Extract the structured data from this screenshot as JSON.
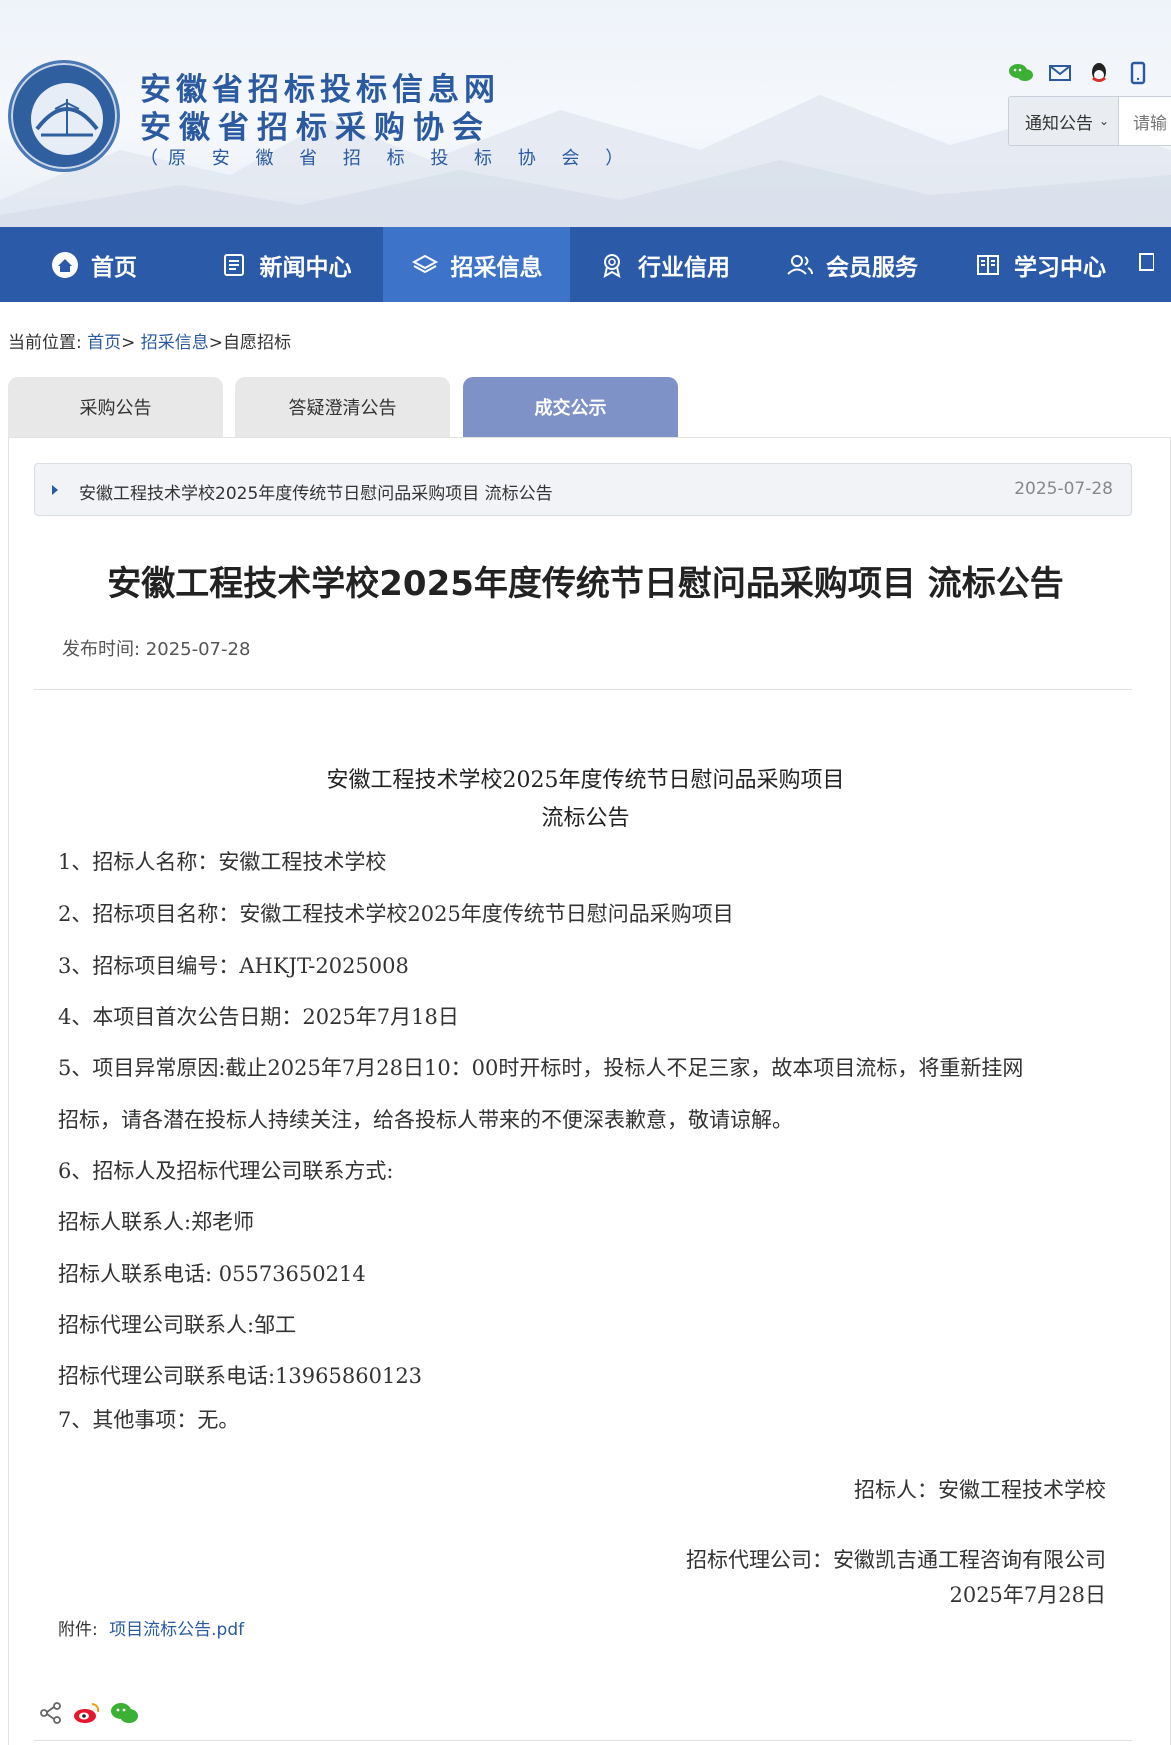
{
  "header": {
    "org_name_1": "安徽省招标投标信息网",
    "org_name_2": "安徽省招标采购协会",
    "org_name_3": "（原 安 徽 省 招 标 投 标 协 会 ）",
    "logo_text": "安徽省招标采购协会",
    "icons": [
      "wechat-icon",
      "mail-icon",
      "qq-icon",
      "mobile-icon"
    ],
    "search": {
      "select_label": "通知公告",
      "placeholder": "请输"
    }
  },
  "nav": {
    "items": [
      {
        "label": "首页",
        "icon": "home-icon"
      },
      {
        "label": "新闻中心",
        "icon": "news-icon"
      },
      {
        "label": "招采信息",
        "icon": "layers-icon"
      },
      {
        "label": "行业信用",
        "icon": "badge-icon"
      },
      {
        "label": "会员服务",
        "icon": "members-icon"
      },
      {
        "label": "学习中心",
        "icon": "book-icon"
      }
    ],
    "active_index": 2
  },
  "breadcrumb": {
    "prefix": "当前位置:",
    "home": "首页",
    "sep1": ">",
    "section": "招采信息",
    "sep2": ">",
    "current": "自愿招标"
  },
  "tabs": [
    {
      "label": "采购公告"
    },
    {
      "label": "答疑澄清公告"
    },
    {
      "label": "成交公示"
    }
  ],
  "active_tab": 2,
  "list_item": {
    "title": "安徽工程技术学校2025年度传统节日慰问品采购项目 流标公告",
    "date": "2025-07-28"
  },
  "article": {
    "title": "安徽工程技术学校2025年度传统节日慰问品采购项目 流标公告",
    "publish_label": "发布时间: 2025-07-28",
    "doc_title_line1": "安徽工程技术学校2025年度传统节日慰问品采购项目",
    "doc_title_line2": "流标公告",
    "lines": [
      "1、招标人名称：安徽工程技术学校",
      "2、招标项目名称：安徽工程技术学校2025年度传统节日慰问品采购项目",
      "3、招标项目编号：AHKJT-2025008",
      "4、本项目首次公告日期：2025年7月18日",
      "5、项目异常原因:截止2025年7月28日10：00时开标时，投标人不足三家，故本项目流标，将重新挂网",
      "招标，请各潜在投标人持续关注，给各投标人带来的不便深表歉意，敬请谅解。",
      "6、招标人及招标代理公司联系方式:",
      "招标人联系人:郑老师",
      "招标人联系电话: 05573650214",
      "招标代理公司联系人:邹工",
      "招标代理公司联系电话:13965860123",
      "7、其他事项：无。"
    ],
    "signature_tenderer": "招标人：安徽工程技术学校",
    "signature_agency": "招标代理公司：安徽凯吉通工程咨询有限公司",
    "signature_date": "2025年7月28日",
    "attachment_label": "附件:",
    "attachment_file": "项目流标公告.pdf"
  },
  "share": {
    "icons": [
      "share-icon",
      "weibo-icon",
      "wechat-share-icon"
    ]
  },
  "colors": {
    "brand_blue": "#2b5aa8",
    "active_nav": "#3d74c9",
    "active_tab": "#7f92c7",
    "link": "#2b5aa0"
  }
}
